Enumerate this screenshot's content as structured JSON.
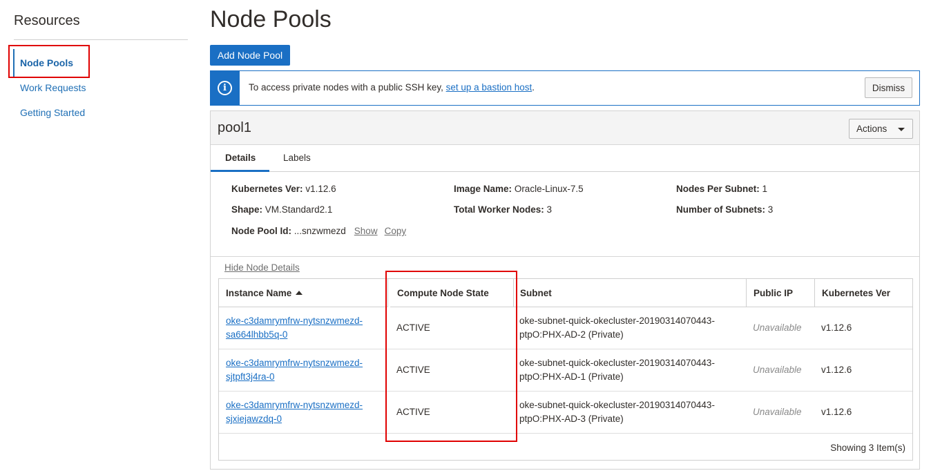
{
  "sidebar": {
    "title": "Resources",
    "items": [
      {
        "label": "Node Pools"
      },
      {
        "label": "Work Requests"
      },
      {
        "label": "Getting Started"
      }
    ]
  },
  "page": {
    "title": "Node Pools",
    "add_button": "Add Node Pool"
  },
  "banner": {
    "icon": "info-icon",
    "text": "To access private nodes with a public SSH key, ",
    "link_text": "set up a bastion host",
    "suffix": ".",
    "dismiss_label": "Dismiss"
  },
  "pool": {
    "name": "pool1",
    "actions_label": "Actions",
    "tabs": [
      {
        "label": "Details"
      },
      {
        "label": "Labels"
      }
    ],
    "details": {
      "k8s_ver_label": "Kubernetes Ver:",
      "k8s_ver_value": "v1.12.6",
      "shape_label": "Shape:",
      "shape_value": "VM.Standard2.1",
      "pool_id_label": "Node Pool Id:",
      "pool_id_value": "...snzwmezd",
      "show_link": "Show",
      "copy_link": "Copy",
      "image_label": "Image Name:",
      "image_value": "Oracle-Linux-7.5",
      "total_label": "Total Worker Nodes:",
      "total_value": "3",
      "nodes_per_subnet_label": "Nodes Per Subnet:",
      "nodes_per_subnet_value": "1",
      "num_subnets_label": "Number of Subnets:",
      "num_subnets_value": "3"
    },
    "hide_link": "Hide Node Details",
    "table": {
      "columns": [
        "Instance Name",
        "Compute Node State",
        "Subnet",
        "Public IP",
        "Kubernetes Ver"
      ],
      "rows": [
        {
          "name_line1": "oke-c3damrymfrw-nytsnzwmezd-",
          "name_line2": "sa664lhbb5q-0",
          "state": "ACTIVE",
          "subnet_line1": "oke-subnet-quick-okecluster-20190314070443-",
          "subnet_line2": "ptpO:PHX-AD-2 (Private)",
          "public_ip": "Unavailable",
          "k8s_ver": "v1.12.6"
        },
        {
          "name_line1": "oke-c3damrymfrw-nytsnzwmezd-",
          "name_line2": "sjtpft3j4ra-0",
          "state": "ACTIVE",
          "subnet_line1": "oke-subnet-quick-okecluster-20190314070443-",
          "subnet_line2": "ptpO:PHX-AD-1 (Private)",
          "public_ip": "Unavailable",
          "k8s_ver": "v1.12.6"
        },
        {
          "name_line1": "oke-c3damrymfrw-nytsnzwmezd-",
          "name_line2": "sjxiejawzdq-0",
          "state": "ACTIVE",
          "subnet_line1": "oke-subnet-quick-okecluster-20190314070443-",
          "subnet_line2": "ptpO:PHX-AD-3 (Private)",
          "public_ip": "Unavailable",
          "k8s_ver": "v1.12.6"
        }
      ],
      "footer": "Showing 3 Item(s)"
    }
  },
  "colors": {
    "primary": "#1a6fc4",
    "highlight": "#e00000",
    "link": "#1f6fb5"
  }
}
